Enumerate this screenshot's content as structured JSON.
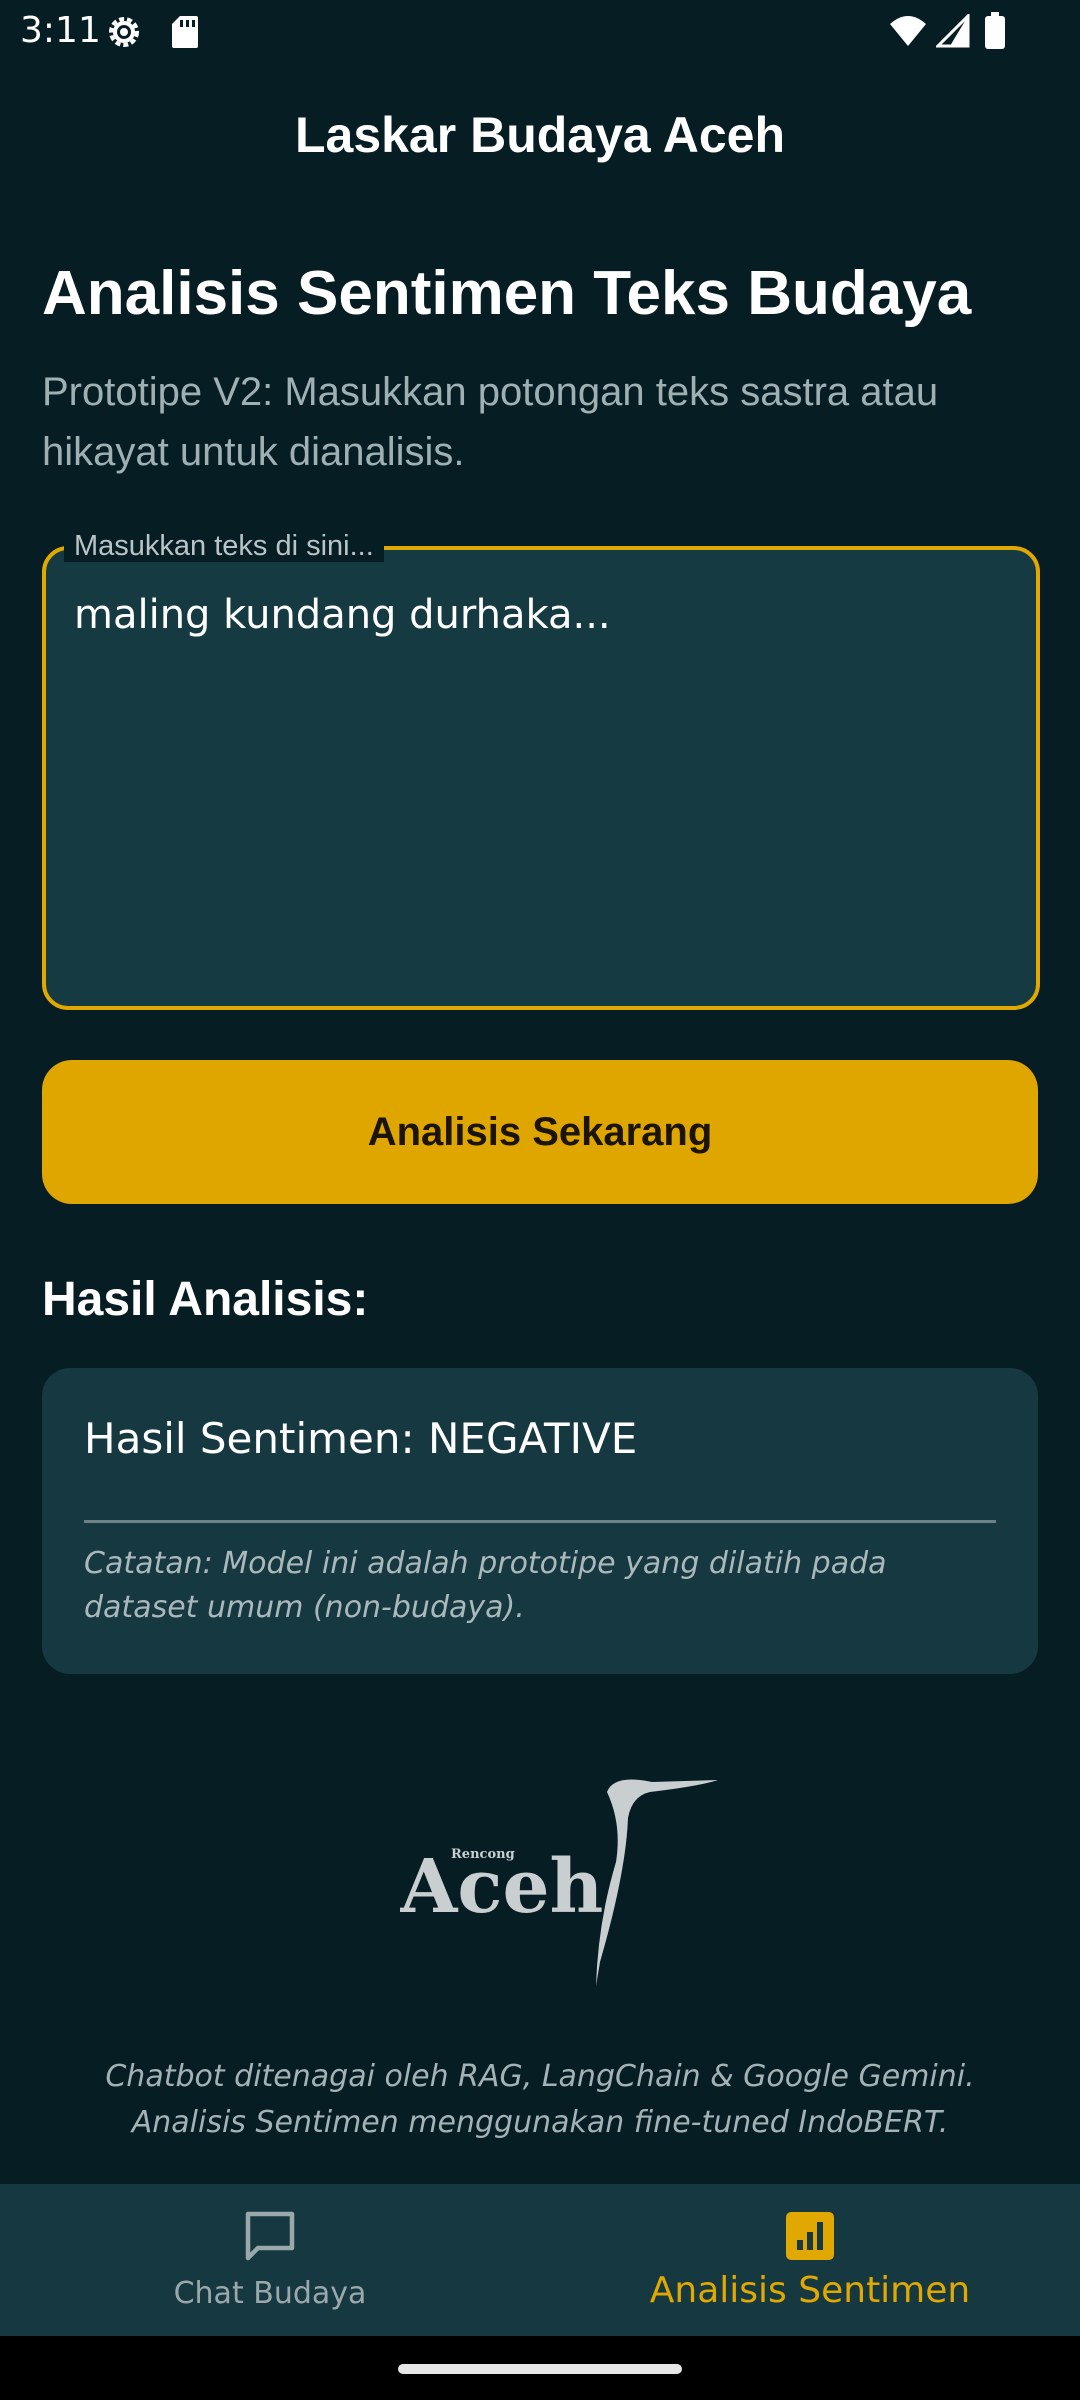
{
  "status_bar": {
    "time": "3:11",
    "icons": [
      "gear-icon",
      "sd-card-icon",
      "wifi-icon",
      "signal-icon",
      "battery-icon"
    ]
  },
  "app_bar": {
    "title": "Laskar Budaya Aceh"
  },
  "page": {
    "title": "Analisis Sentimen Teks Budaya",
    "description": "Prototipe V2: Masukkan potongan teks sastra atau hikayat untuk dianalisis."
  },
  "input": {
    "label": "Masukkan teks di sini...",
    "value": "maling kundang durhaka..."
  },
  "analyze_button": {
    "label": "Analisis Sekarang"
  },
  "results": {
    "title": "Hasil Analisis:",
    "sentiment": "Hasil Sentimen: NEGATIVE",
    "note": "Catatan: Model ini adalah prototipe yang dilatih pada dataset umum (non-budaya)."
  },
  "logo": {
    "small_text": "Rencong",
    "main_text": "Aceh"
  },
  "footer": {
    "line1": "Chatbot ditenagai oleh RAG, LangChain & Google Gemini.",
    "line2": "Analisis Sentimen menggunakan fine-tuned IndoBERT."
  },
  "bottom_nav": {
    "items": [
      {
        "label": "Chat Budaya",
        "icon": "chat-bubble-icon",
        "active": false
      },
      {
        "label": "Analisis Sentimen",
        "icon": "bar-chart-icon",
        "active": true
      }
    ]
  },
  "colors": {
    "background": "#061d23",
    "surface": "#163840",
    "accent": "#e0a800"
  }
}
